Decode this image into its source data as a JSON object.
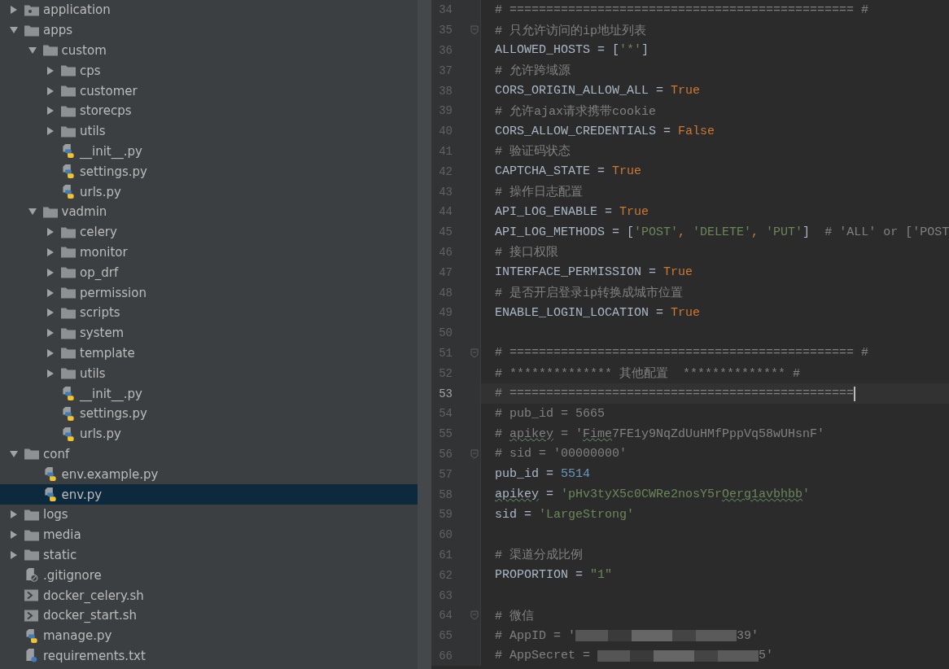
{
  "project_tree": {
    "items": [
      {
        "name": "application",
        "kind": "module",
        "expanded": false,
        "selected": false
      },
      {
        "name": "apps",
        "kind": "folder",
        "expanded": true,
        "selected": false,
        "children": [
          {
            "name": "custom",
            "kind": "folder",
            "expanded": true,
            "selected": false,
            "children": [
              {
                "name": "cps",
                "kind": "folder",
                "expanded": false,
                "selected": false
              },
              {
                "name": "customer",
                "kind": "folder",
                "expanded": false,
                "selected": false
              },
              {
                "name": "storecps",
                "kind": "folder",
                "expanded": false,
                "selected": false
              },
              {
                "name": "utils",
                "kind": "folder",
                "expanded": false,
                "selected": false
              },
              {
                "name": "__init__.py",
                "kind": "python",
                "selected": false
              },
              {
                "name": "settings.py",
                "kind": "python",
                "selected": false
              },
              {
                "name": "urls.py",
                "kind": "python",
                "selected": false
              }
            ]
          },
          {
            "name": "vadmin",
            "kind": "folder",
            "expanded": true,
            "selected": false,
            "children": [
              {
                "name": "celery",
                "kind": "folder",
                "expanded": false,
                "selected": false
              },
              {
                "name": "monitor",
                "kind": "folder",
                "expanded": false,
                "selected": false
              },
              {
                "name": "op_drf",
                "kind": "folder",
                "expanded": false,
                "selected": false
              },
              {
                "name": "permission",
                "kind": "folder",
                "expanded": false,
                "selected": false
              },
              {
                "name": "scripts",
                "kind": "folder",
                "expanded": false,
                "selected": false
              },
              {
                "name": "system",
                "kind": "folder",
                "expanded": false,
                "selected": false
              },
              {
                "name": "template",
                "kind": "folder",
                "expanded": false,
                "selected": false
              },
              {
                "name": "utils",
                "kind": "folder",
                "expanded": false,
                "selected": false
              },
              {
                "name": "__init__.py",
                "kind": "python",
                "selected": false
              },
              {
                "name": "settings.py",
                "kind": "python",
                "selected": false
              },
              {
                "name": "urls.py",
                "kind": "python",
                "selected": false
              }
            ]
          }
        ]
      },
      {
        "name": "conf",
        "kind": "folder",
        "expanded": true,
        "selected": false,
        "children": [
          {
            "name": "env.example.py",
            "kind": "python",
            "selected": false
          },
          {
            "name": "env.py",
            "kind": "python",
            "selected": true
          }
        ]
      },
      {
        "name": "logs",
        "kind": "folder",
        "expanded": false,
        "selected": false
      },
      {
        "name": "media",
        "kind": "folder",
        "expanded": false,
        "selected": false
      },
      {
        "name": "static",
        "kind": "folder",
        "expanded": false,
        "selected": false
      },
      {
        "name": ".gitignore",
        "kind": "ignore",
        "selected": false
      },
      {
        "name": "docker_celery.sh",
        "kind": "shell",
        "selected": false
      },
      {
        "name": "docker_start.sh",
        "kind": "shell",
        "selected": false
      },
      {
        "name": "manage.py",
        "kind": "python",
        "selected": false
      },
      {
        "name": "requirements.txt",
        "kind": "text",
        "selected": false
      }
    ]
  },
  "editor": {
    "lines": [
      {
        "number": "34",
        "current": false,
        "fold": false,
        "tokens": [
          {
            "text": "# =============================================== #",
            "kind": "comment"
          }
        ]
      },
      {
        "number": "35",
        "current": false,
        "fold": true,
        "tokens": [
          {
            "text": "# 只允许访问的ip地址列表",
            "kind": "comment"
          }
        ]
      },
      {
        "number": "36",
        "current": false,
        "fold": false,
        "tokens": [
          {
            "text": "ALLOWED_HOSTS = [",
            "kind": "plain"
          },
          {
            "text": "'*'",
            "kind": "string"
          },
          {
            "text": "]",
            "kind": "plain"
          }
        ]
      },
      {
        "number": "37",
        "current": false,
        "fold": false,
        "tokens": [
          {
            "text": "# 允许跨域源",
            "kind": "comment"
          }
        ]
      },
      {
        "number": "38",
        "current": false,
        "fold": false,
        "tokens": [
          {
            "text": "CORS_ORIGIN_ALLOW_ALL = ",
            "kind": "plain"
          },
          {
            "text": "True",
            "kind": "keyword"
          }
        ]
      },
      {
        "number": "39",
        "current": false,
        "fold": false,
        "tokens": [
          {
            "text": "# 允许ajax请求携带cookie",
            "kind": "comment"
          }
        ]
      },
      {
        "number": "40",
        "current": false,
        "fold": false,
        "tokens": [
          {
            "text": "CORS_ALLOW_CREDENTIALS = ",
            "kind": "plain"
          },
          {
            "text": "False",
            "kind": "keyword"
          }
        ]
      },
      {
        "number": "41",
        "current": false,
        "fold": false,
        "tokens": [
          {
            "text": "# 验证码状态",
            "kind": "comment"
          }
        ]
      },
      {
        "number": "42",
        "current": false,
        "fold": false,
        "tokens": [
          {
            "text": "CAPTCHA_STATE = ",
            "kind": "plain"
          },
          {
            "text": "True",
            "kind": "keyword"
          }
        ]
      },
      {
        "number": "43",
        "current": false,
        "fold": false,
        "tokens": [
          {
            "text": "# 操作日志配置",
            "kind": "comment"
          }
        ]
      },
      {
        "number": "44",
        "current": false,
        "fold": false,
        "tokens": [
          {
            "text": "API_LOG_ENABLE = ",
            "kind": "plain"
          },
          {
            "text": "True",
            "kind": "keyword"
          }
        ]
      },
      {
        "number": "45",
        "current": false,
        "fold": false,
        "tokens": [
          {
            "text": "API_LOG_METHODS = [",
            "kind": "plain"
          },
          {
            "text": "'POST'",
            "kind": "string"
          },
          {
            "text": ", ",
            "kind": "keyword"
          },
          {
            "text": "'DELETE'",
            "kind": "string"
          },
          {
            "text": ", ",
            "kind": "keyword"
          },
          {
            "text": "'PUT'",
            "kind": "string"
          },
          {
            "text": "]  ",
            "kind": "plain"
          },
          {
            "text": "# 'ALL' or ['POST",
            "kind": "comment"
          }
        ]
      },
      {
        "number": "46",
        "current": false,
        "fold": false,
        "tokens": [
          {
            "text": "# 接口权限",
            "kind": "comment"
          }
        ]
      },
      {
        "number": "47",
        "current": false,
        "fold": false,
        "tokens": [
          {
            "text": "INTERFACE_PERMISSION = ",
            "kind": "plain"
          },
          {
            "text": "True",
            "kind": "keyword"
          }
        ]
      },
      {
        "number": "48",
        "current": false,
        "fold": false,
        "tokens": [
          {
            "text": "# 是否开启登录ip转换成城市位置",
            "kind": "comment"
          }
        ]
      },
      {
        "number": "49",
        "current": false,
        "fold": false,
        "tokens": [
          {
            "text": "ENABLE_LOGIN_LOCATION = ",
            "kind": "plain"
          },
          {
            "text": "True",
            "kind": "keyword"
          }
        ]
      },
      {
        "number": "50",
        "current": false,
        "fold": false
      },
      {
        "number": "51",
        "current": false,
        "fold": true,
        "tokens": [
          {
            "text": "# =============================================== #",
            "kind": "comment"
          }
        ]
      },
      {
        "number": "52",
        "current": false,
        "fold": false,
        "tokens": [
          {
            "text": "# ************** 其他配置  ************** #",
            "kind": "comment"
          }
        ]
      },
      {
        "number": "53",
        "current": true,
        "fold": false,
        "tokens": [
          {
            "text": "# ===============================================",
            "kind": "comment"
          }
        ]
      },
      {
        "number": "54",
        "current": false,
        "fold": false,
        "tokens": [
          {
            "text": "# pub_id = 5665",
            "kind": "comment"
          }
        ]
      },
      {
        "number": "55",
        "current": false,
        "fold": false,
        "tokens": [
          {
            "text": "# ",
            "kind": "comment"
          },
          {
            "text": "apikey",
            "kind": "comment",
            "typo": true
          },
          {
            "text": " = '",
            "kind": "comment"
          },
          {
            "text": "Fime",
            "kind": "comment",
            "typo": true
          },
          {
            "text": "7FE1y9NqZdUuHMfPppVq58wUHsnF'",
            "kind": "comment"
          }
        ]
      },
      {
        "number": "56",
        "current": false,
        "fold": true,
        "tokens": [
          {
            "text": "# sid = '00000000'",
            "kind": "comment"
          }
        ]
      },
      {
        "number": "57",
        "current": false,
        "fold": false,
        "tokens": [
          {
            "text": "pub_id = ",
            "kind": "plain"
          },
          {
            "text": "5514",
            "kind": "number"
          }
        ]
      },
      {
        "number": "58",
        "current": false,
        "fold": false,
        "tokens": [
          {
            "text": "apikey",
            "kind": "plain",
            "typo": true
          },
          {
            "text": " = ",
            "kind": "plain"
          },
          {
            "text": "'pHv3tyX5c0CWRe2nosY5r",
            "kind": "string"
          },
          {
            "text": "Oerg1avbhbb",
            "kind": "string",
            "typo": true
          },
          {
            "text": "'",
            "kind": "string"
          }
        ]
      },
      {
        "number": "59",
        "current": false,
        "fold": false,
        "tokens": [
          {
            "text": "sid = ",
            "kind": "plain"
          },
          {
            "text": "'LargeStrong'",
            "kind": "string"
          }
        ]
      },
      {
        "number": "60",
        "current": false,
        "fold": false
      },
      {
        "number": "61",
        "current": false,
        "fold": false,
        "tokens": [
          {
            "text": "# 渠道分成比例",
            "kind": "comment"
          }
        ]
      },
      {
        "number": "62",
        "current": false,
        "fold": false,
        "tokens": [
          {
            "text": "PROPORTION = ",
            "kind": "plain"
          },
          {
            "text": "\"1\"",
            "kind": "string"
          }
        ]
      },
      {
        "number": "63",
        "current": false,
        "fold": false
      },
      {
        "number": "64",
        "current": false,
        "fold": true,
        "tokens": [
          {
            "text": "# 微信",
            "kind": "comment"
          }
        ]
      },
      {
        "number": "65",
        "current": false,
        "fold": false,
        "tokens": [
          {
            "text": "# AppID = '",
            "kind": "comment"
          },
          {
            "kind": "redacted"
          },
          {
            "text": "39'",
            "kind": "comment"
          }
        ]
      },
      {
        "number": "66",
        "current": false,
        "fold": false,
        "tokens": [
          {
            "text": "# AppSecret = ",
            "kind": "comment"
          },
          {
            "kind": "redacted"
          },
          {
            "text": "5'",
            "kind": "comment"
          }
        ]
      }
    ]
  }
}
